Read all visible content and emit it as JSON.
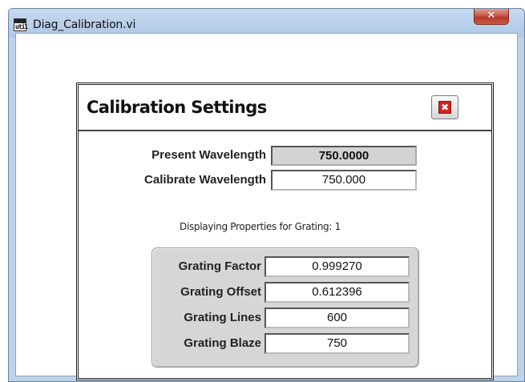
{
  "window": {
    "title": "Diag_Calibration.vi",
    "icon_text": "util",
    "close_glyph": "✕"
  },
  "panel": {
    "title": "Calibration Settings",
    "close_glyph": "✖"
  },
  "present_wavelength": {
    "label": "Present Wavelength",
    "value": "750.0000"
  },
  "calibrate_wavelength": {
    "label": "Calibrate Wavelength",
    "value": "750.000"
  },
  "grating_info": "Displaying Properties for Grating: 1",
  "grating": {
    "factor": {
      "label": "Grating Factor",
      "value": "0.999270"
    },
    "offset": {
      "label": "Grating Offset",
      "value": "0.612396"
    },
    "lines": {
      "label": "Grating Lines",
      "value": "600"
    },
    "blaze": {
      "label": "Grating Blaze",
      "value": "750"
    }
  },
  "colors": {
    "window_frame": "#bcd3ea",
    "close_red": "#c9574a",
    "indicator_gray": "#d3d3d3",
    "panel_close_red": "#d42020"
  }
}
